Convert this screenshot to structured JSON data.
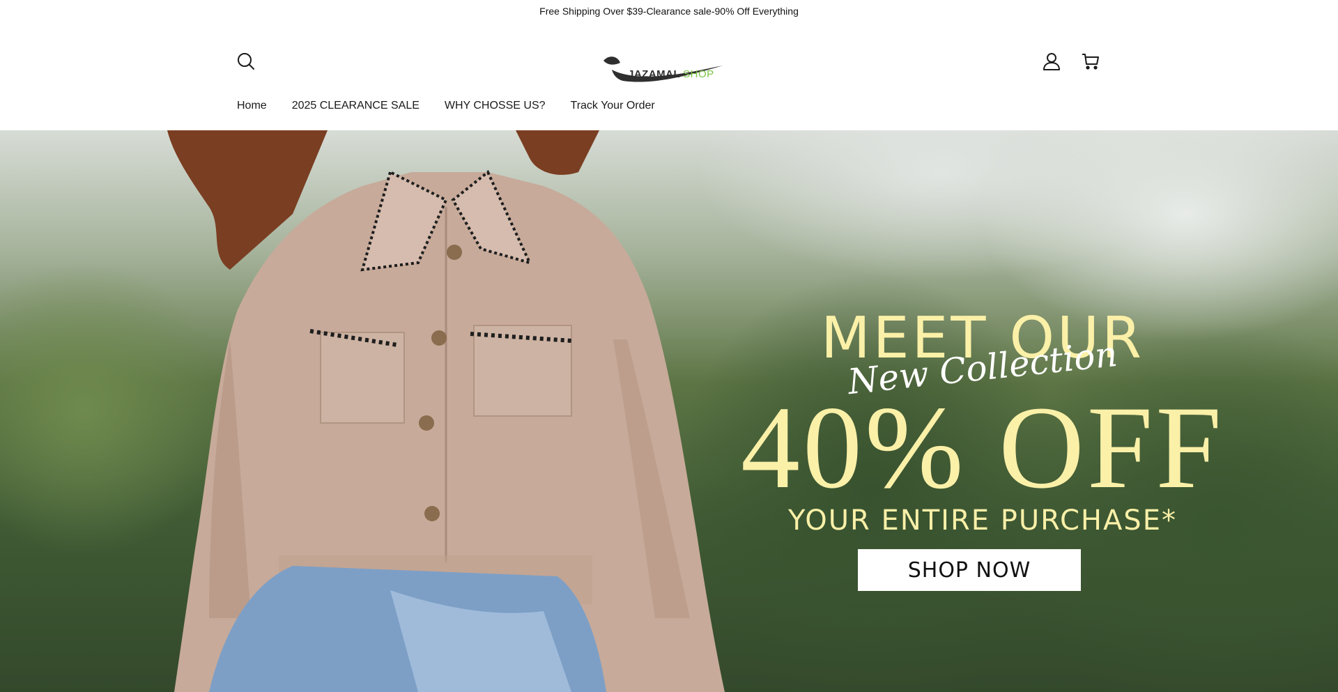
{
  "announcement": {
    "text": "Free Shipping Over $39-Clearance sale-90% Off Everything"
  },
  "header": {
    "logo": {
      "brand": "JAZAMAL",
      "suffix": "SHOP"
    },
    "icons": {
      "search": "search-icon",
      "account": "user-icon",
      "cart": "cart-icon"
    }
  },
  "nav": {
    "items": [
      {
        "label": "Home"
      },
      {
        "label": "2025 CLEARANCE SALE"
      },
      {
        "label": "WHY CHOSSE US?"
      },
      {
        "label": "Track Your Order"
      }
    ]
  },
  "hero": {
    "headline": "MEET OUR",
    "script": "New Collection",
    "discount": "40% OFF",
    "subline": "YOUR ENTIRE PURCHASE*",
    "cta": "SHOP NOW",
    "colors": {
      "accent": "#fbf0a8",
      "button_bg": "#ffffff",
      "logo_green": "#7cc242"
    }
  }
}
